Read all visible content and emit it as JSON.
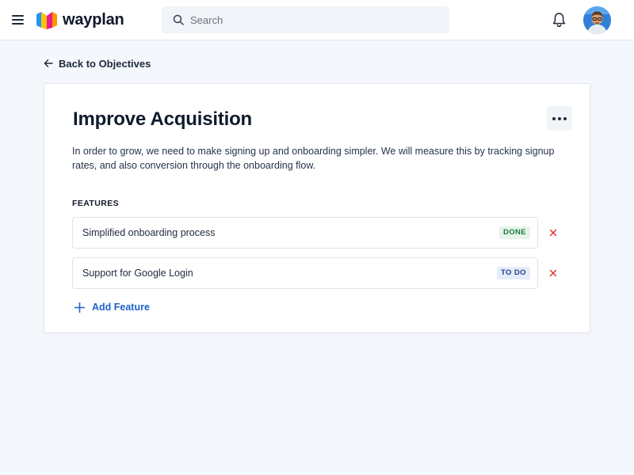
{
  "app": {
    "name": "wayplan"
  },
  "header": {
    "search": {
      "placeholder": "Search",
      "value": ""
    },
    "icons": [
      "menu-icon",
      "bell-icon",
      "search-icon"
    ]
  },
  "nav": {
    "back_label": "Back to Objectives"
  },
  "objective": {
    "title": "Improve Acquisition",
    "description": "In order to grow, we need to make signing up and onboarding simpler. We will measure this by tracking signup rates, and also conversion through the onboarding flow.",
    "features_heading": "FEATURES",
    "features": [
      {
        "name": "Simplified onboarding process",
        "status": "DONE"
      },
      {
        "name": "Support for Google Login",
        "status": "TO DO"
      }
    ],
    "add_feature_label": "Add Feature"
  },
  "colors": {
    "accent": "#1f63c9",
    "done_bg": "#e6f4ea",
    "done_text": "#1f7a3b",
    "todo_bg": "#e5edfb",
    "todo_text": "#1f3f8a",
    "remove": "#d93025"
  }
}
